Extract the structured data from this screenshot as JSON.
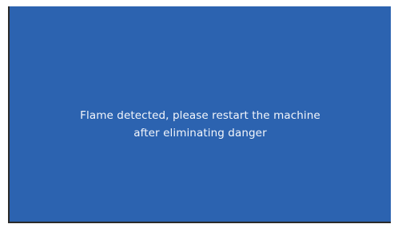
{
  "screen": {
    "background_color": "#2c63b0",
    "text_color": "#f3f6fb"
  },
  "alert": {
    "line1": "Flame detected, please restart the machine",
    "line2": "after eliminating danger"
  }
}
